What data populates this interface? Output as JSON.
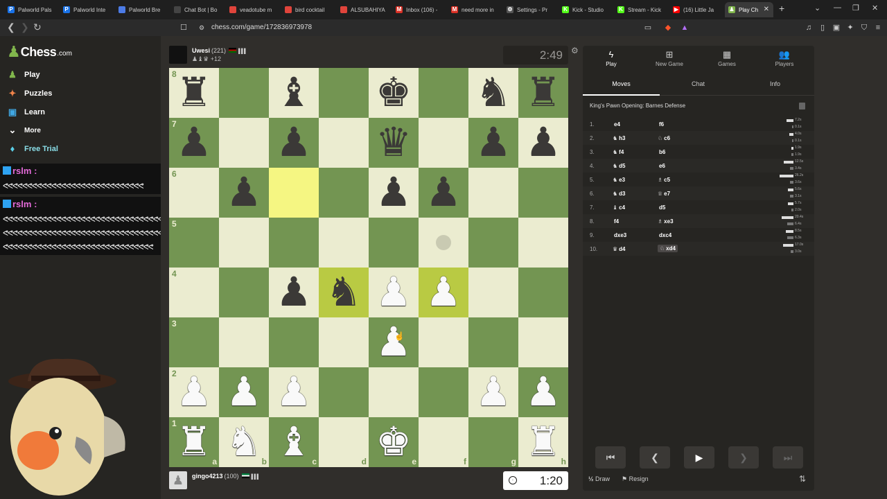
{
  "browser": {
    "tabs": [
      {
        "label": "Palworld Pals",
        "fav": "P",
        "color": "#1a73e8"
      },
      {
        "label": "Palworld Inte",
        "fav": "P",
        "color": "#1a73e8"
      },
      {
        "label": "Palworld Bre",
        "fav": "",
        "color": "#4c7be6"
      },
      {
        "label": "Chat Bot | Bo",
        "fav": "",
        "color": "#444444"
      },
      {
        "label": "veadotube m",
        "fav": "",
        "color": "#e0443b"
      },
      {
        "label": "bird cocktail",
        "fav": "",
        "color": "#e0443b"
      },
      {
        "label": "ALSUBAHIYA",
        "fav": "",
        "color": "#e0443b"
      },
      {
        "label": "Inbox (106) -",
        "fav": "M",
        "color": "#d93025"
      },
      {
        "label": "need more in",
        "fav": "M",
        "color": "#d93025"
      },
      {
        "label": "Settings - Pr",
        "fav": "⚙",
        "color": "#555555"
      },
      {
        "label": "Kick - Studio",
        "fav": "K",
        "color": "#53fc18"
      },
      {
        "label": "Stream - Kick",
        "fav": "K",
        "color": "#53fc18"
      },
      {
        "label": "(16) Little Ja",
        "fav": "▶",
        "color": "#ff0000"
      },
      {
        "label": "Play Ch",
        "fav": "♟",
        "color": "#81b64c"
      }
    ],
    "url": "chess.com/game/172836973978"
  },
  "nav": {
    "logo_text": "Chess",
    "logo_suffix": ".com",
    "items": [
      {
        "label": "Play",
        "icon": "♟"
      },
      {
        "label": "Puzzles",
        "icon": "✦"
      },
      {
        "label": "Learn",
        "icon": "▣"
      },
      {
        "label": "More",
        "icon": "⌄"
      },
      {
        "label": "Free Trial",
        "icon": "♦"
      }
    ]
  },
  "chat": {
    "messages": [
      {
        "user": "rslm",
        "sep": ":",
        "text": "ᕙᕙᕙᕙᕙᕙᕙᕙᕙᕙᕙᕙᕙᕙᕙᕙᕙᕙᕙᕙᕙᕙᕙᕙᕙᕙᕙᕙᕙ",
        "lines": 1
      },
      {
        "user": "rslm",
        "sep": ":",
        "text1": "ᕙᕙᕙᕙᕙᕙᕙᕙᕙᕙᕙᕙᕙᕙᕙᕙᕙᕙᕙᕙᕙᕙᕙᕙᕙᕙᕙᕙᕙᕙᕙᕙᕙᕙᕙᕙ",
        "text2": "ᕙᕙᕙᕙᕙᕙᕙᕙᕙᕙᕙᕙᕙᕙᕙᕙᕙᕙᕙᕙᕙᕙᕙᕙᕙᕙᕙᕙᕙᕙᕙᕙᕙᕙᕙᕙ",
        "text3": "ᕙᕙᕙᕙᕙᕙᕙᕙᕙᕙᕙᕙᕙᕙᕙᕙᕙᕙᕙᕙᕙᕙᕙᕙᕙᕙᕙᕙᕙᕙᕙ"
      }
    ]
  },
  "game": {
    "top_player": {
      "name": "Uwesi",
      "rating": "(221)",
      "captured": "♟♝♛",
      "advantage": "+12",
      "clock": "2:49"
    },
    "bottom_player": {
      "name": "gingo4213",
      "rating": "(100)",
      "captured": "",
      "clock": "1:20"
    },
    "board": [
      [
        "bR",
        "",
        "bB",
        "",
        "bK",
        "",
        "bN",
        "bR"
      ],
      [
        "bP",
        "",
        "bP",
        "",
        "bQ",
        "",
        "bP",
        "bP"
      ],
      [
        "",
        "bP",
        "",
        "",
        "bP",
        "bP",
        "",
        ""
      ],
      [
        "",
        "",
        "",
        "",
        "",
        "",
        "",
        ""
      ],
      [
        "",
        "",
        "bP",
        "bN",
        "wP",
        "wP",
        "",
        ""
      ],
      [
        "",
        "",
        "",
        "",
        "wP",
        "",
        "",
        ""
      ],
      [
        "wP",
        "wP",
        "wP",
        "",
        "",
        "",
        "wP",
        "wP"
      ],
      [
        "wR",
        "wN",
        "wB",
        "",
        "wK",
        "",
        "",
        "wR"
      ]
    ],
    "highlights": [
      [
        2,
        2
      ],
      [
        4,
        3
      ],
      [
        4,
        5
      ]
    ],
    "hints": [
      [
        3,
        5
      ]
    ],
    "ranks": [
      "8",
      "7",
      "6",
      "5",
      "4",
      "3",
      "2",
      "1"
    ],
    "files": [
      "a",
      "b",
      "c",
      "d",
      "e",
      "f",
      "g",
      "h"
    ]
  },
  "panel": {
    "tabs": [
      {
        "label": "Play",
        "icon": "ϟ"
      },
      {
        "label": "New Game",
        "icon": "⊞"
      },
      {
        "label": "Games",
        "icon": "▦"
      },
      {
        "label": "Players",
        "icon": "👥"
      }
    ],
    "subtabs": [
      "Moves",
      "Chat",
      "Info"
    ],
    "opening": "King's Pawn Opening: Barnes Defense",
    "moves": [
      {
        "n": "1.",
        "wi": "",
        "w": "e4",
        "bi": "",
        "b": "f6",
        "t1": "7.2s",
        "t2": "0.1s",
        "w1": 10,
        "w2": 2
      },
      {
        "n": "2.",
        "wi": "♞",
        "w": "h3",
        "bi": "♘",
        "b": "c6",
        "t1": "4.0s",
        "t2": "0.1s",
        "w1": 6,
        "w2": 2
      },
      {
        "n": "3.",
        "wi": "♞",
        "w": "f4",
        "bi": "",
        "b": "b6",
        "t1": "1.9s",
        "t2": "1.9s",
        "w1": 3,
        "w2": 3
      },
      {
        "n": "4.",
        "wi": "♞",
        "w": "d5",
        "bi": "",
        "b": "e6",
        "t1": "12.5s",
        "t2": "3.4s",
        "w1": 14,
        "w2": 5
      },
      {
        "n": "5.",
        "wi": "♞",
        "w": "e3",
        "bi": "♗",
        "b": "c5",
        "t1": "26.2s",
        "t2": "3.6s",
        "w1": 20,
        "w2": 5
      },
      {
        "n": "6.",
        "wi": "♞",
        "w": "d3",
        "bi": "♕",
        "b": "e7",
        "t1": "5.6s",
        "t2": "3.1s",
        "w1": 8,
        "w2": 5
      },
      {
        "n": "7.",
        "wi": "♝",
        "w": "c4",
        "bi": "",
        "b": "d5",
        "t1": "5.7s",
        "t2": "2.0s",
        "w1": 8,
        "w2": 3
      },
      {
        "n": "8.",
        "wi": "",
        "w": "f4",
        "bi": "♗",
        "b": "xe3",
        "t1": "20.4s",
        "t2": "6.4s",
        "w1": 17,
        "w2": 9
      },
      {
        "n": "9.",
        "wi": "",
        "w": "dxe3",
        "bi": "",
        "b": "dxc4",
        "t1": "8.5s",
        "t2": "6.3s",
        "w1": 11,
        "w2": 9
      },
      {
        "n": "10.",
        "wi": "♛",
        "w": "d4",
        "bi": "♘",
        "b": "xd4",
        "t1": "17.0s",
        "t2": "3.0s",
        "w1": 15,
        "w2": 4
      }
    ],
    "controls": [
      {
        "icon": "⏮",
        "enabled": true
      },
      {
        "icon": "❮",
        "enabled": true
      },
      {
        "icon": "▶",
        "enabled": true
      },
      {
        "icon": "❯",
        "enabled": false
      },
      {
        "icon": "⏭",
        "enabled": false
      }
    ],
    "draw_label": "Draw",
    "draw_icon": "½",
    "resign_label": "Resign",
    "resign_icon": "⚑"
  }
}
